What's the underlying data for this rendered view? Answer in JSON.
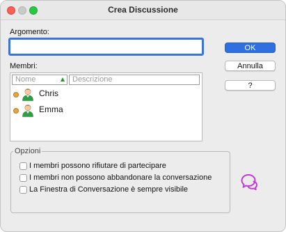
{
  "window": {
    "title": "Crea Discussione"
  },
  "subject": {
    "label": "Argomento:",
    "value": ""
  },
  "members": {
    "label": "Membri:",
    "columns": {
      "name": "Nome",
      "description": "Descrizione"
    },
    "items": [
      {
        "name": "Chris",
        "description": ""
      },
      {
        "name": "Emma",
        "description": ""
      }
    ]
  },
  "buttons": {
    "ok": "OK",
    "cancel": "Annulla",
    "help": "?"
  },
  "options": {
    "legend": "Opzioni",
    "items": [
      {
        "label": "I membri possono rifiutare di partecipare",
        "checked": false
      },
      {
        "label": "I membri non possono abbandonare la conversazione",
        "checked": false
      },
      {
        "label": "La Finestra di Conversazione è sempre visibile",
        "checked": false
      }
    ]
  },
  "colors": {
    "accent": "#2f6fe0",
    "focus_ring": "#3a74d8",
    "status_dot": "#e2a446",
    "chat_icon": "#c23ad0",
    "sort_indicator": "#1f9a2a"
  },
  "icons": {
    "avatar": "user-avatar-icon",
    "status": "status-dot-icon",
    "chat": "chat-bubbles-icon"
  }
}
